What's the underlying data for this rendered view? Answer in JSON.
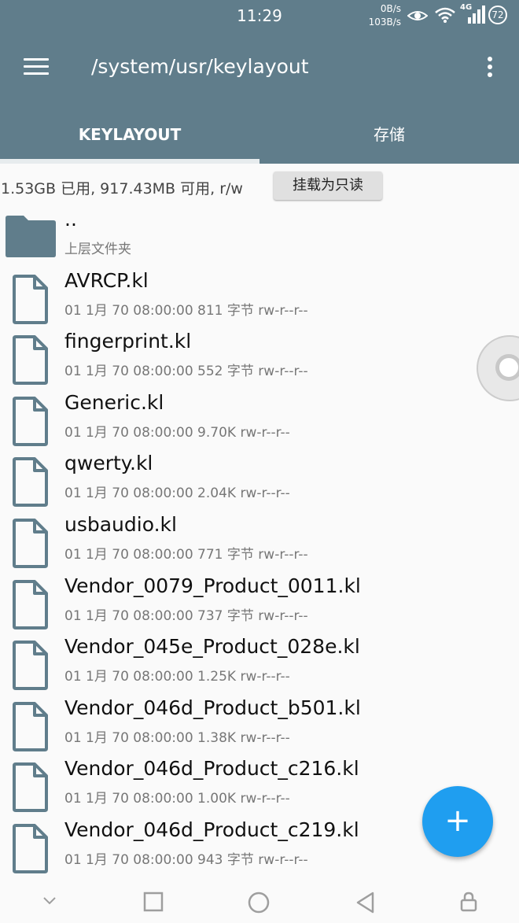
{
  "status_bar": {
    "time": "11:29",
    "net_speed_up": "0B/s",
    "net_speed_down": "103B/s",
    "network_type": "4G",
    "battery": "72"
  },
  "app_bar": {
    "path": "/system/usr/keylayout",
    "tabs": [
      {
        "label": "KEYLAYOUT",
        "active": true
      },
      {
        "label": "存储",
        "active": false
      }
    ]
  },
  "storage": {
    "usage": "1.53GB 已用, 917.43MB 可用, r/w",
    "readonly_button": "挂载为只读"
  },
  "files": [
    {
      "name": "..",
      "meta": "上层文件夹",
      "type": "folder"
    },
    {
      "name": "AVRCP.kl",
      "meta": "01 1月 70 08:00:00  811 字节  rw-r--r--",
      "type": "file"
    },
    {
      "name": "fingerprint.kl",
      "meta": "01 1月 70 08:00:00  552 字节  rw-r--r--",
      "type": "file"
    },
    {
      "name": "Generic.kl",
      "meta": "01 1月 70 08:00:00  9.70K  rw-r--r--",
      "type": "file"
    },
    {
      "name": "qwerty.kl",
      "meta": "01 1月 70 08:00:00  2.04K  rw-r--r--",
      "type": "file"
    },
    {
      "name": "usbaudio.kl",
      "meta": "01 1月 70 08:00:00  771 字节  rw-r--r--",
      "type": "file"
    },
    {
      "name": "Vendor_0079_Product_0011.kl",
      "meta": "01 1月 70 08:00:00  737 字节  rw-r--r--",
      "type": "file"
    },
    {
      "name": "Vendor_045e_Product_028e.kl",
      "meta": "01 1月 70 08:00:00  1.25K  rw-r--r--",
      "type": "file"
    },
    {
      "name": "Vendor_046d_Product_b501.kl",
      "meta": "01 1月 70 08:00:00  1.38K  rw-r--r--",
      "type": "file"
    },
    {
      "name": "Vendor_046d_Product_c216.kl",
      "meta": "01 1月 70 08:00:00  1.00K  rw-r--r--",
      "type": "file"
    },
    {
      "name": "Vendor_046d_Product_c219.kl",
      "meta": "01 1月 70 08:00:00  943 字节  rw-r--r--",
      "type": "file"
    }
  ],
  "fab": {
    "label": "+"
  },
  "colors": {
    "app_bar": "#607d8b",
    "fab": "#1f9ef0",
    "icon": "#607d8b"
  }
}
